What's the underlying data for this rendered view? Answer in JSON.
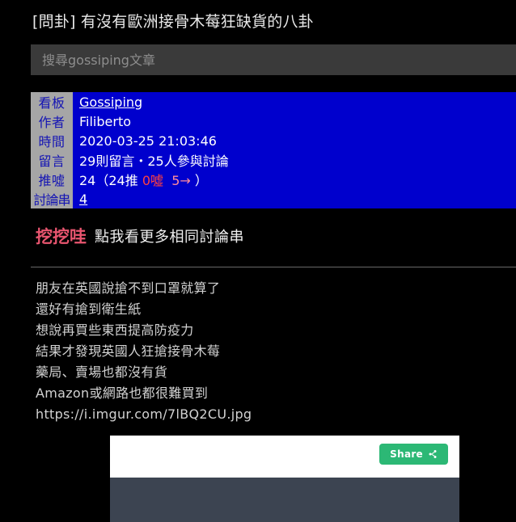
{
  "post": {
    "title": "[問卦] 有沒有歐洲接骨木莓狂缺貨的八卦"
  },
  "search": {
    "placeholder": "搜尋gossiping文章",
    "value": ""
  },
  "meta": {
    "rows": [
      {
        "label": "看板",
        "value": "Gossiping",
        "is_link": true
      },
      {
        "label": "作者",
        "value": "Filiberto",
        "is_link": false
      },
      {
        "label": "時間",
        "value": "2020-03-25 21:03:46",
        "is_link": false
      },
      {
        "label": "留言",
        "value": "29則留言・25人參與討論",
        "is_link": false
      },
      {
        "label": "推噓",
        "value": "",
        "is_link": false
      },
      {
        "label": "討論串",
        "value": "4",
        "is_link": true
      }
    ],
    "push": {
      "total": "24",
      "open_paren": "（",
      "up": "24推",
      "boo": "0噓",
      "arrow": "5→",
      "close_paren": "）"
    }
  },
  "wawa": {
    "brand": "挖挖哇",
    "text": "點我看更多相同討論串"
  },
  "body": {
    "lines": [
      "朋友在英國說搶不到口罩就算了",
      "還好有搶到衛生紙",
      "想說再買些東西提高防疫力",
      "結果才發現英國人狂搶接骨木莓",
      "藥局、賣場也都沒有貨",
      "Amazon或網路也都很難買到",
      "https://i.imgur.com/7lBQ2CU.jpg"
    ]
  },
  "embed": {
    "share_label": "Share",
    "share_icon": "share-icon"
  },
  "colors": {
    "page_background": "#000000",
    "meta_value_background": "#0000cd",
    "meta_label_background": "#a6a6a6",
    "meta_label_text": "#1414b4",
    "boo_text": "#ff4040",
    "arrow_text": "#ff8b9c",
    "wawa_brand": "#e8556f",
    "share_button": "#2cb875",
    "embed_image_placeholder": "#3c4451"
  }
}
